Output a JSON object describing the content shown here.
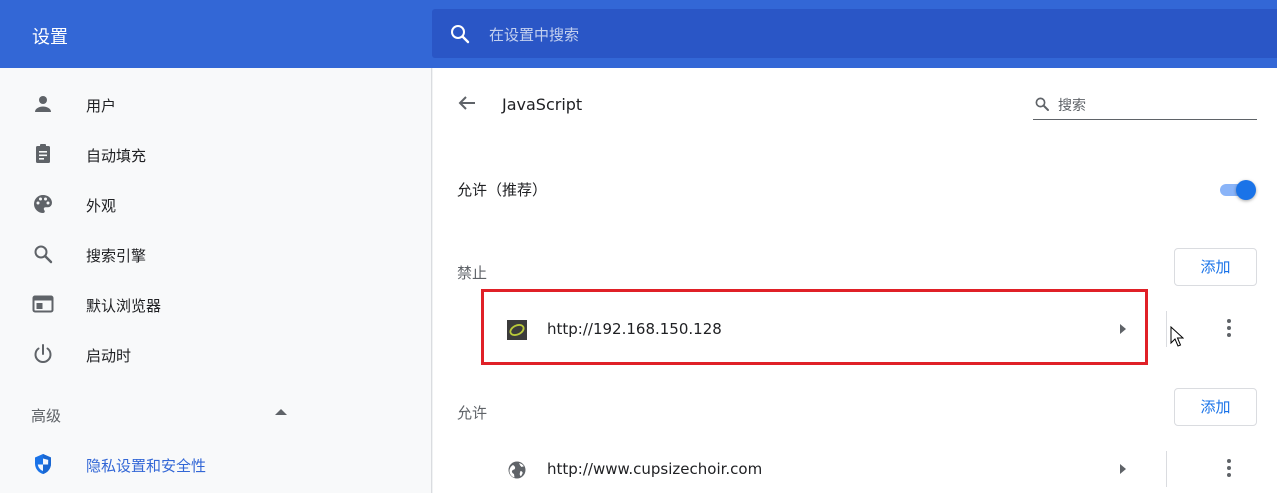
{
  "header": {
    "title": "设置",
    "search_placeholder": "在设置中搜索"
  },
  "sidebar": {
    "items": [
      {
        "label": "用户",
        "icon": "person-icon"
      },
      {
        "label": "自动填充",
        "icon": "clipboard-icon"
      },
      {
        "label": "外观",
        "icon": "palette-icon"
      },
      {
        "label": "搜索引擎",
        "icon": "search-icon"
      },
      {
        "label": "默认浏览器",
        "icon": "browser-window-icon"
      },
      {
        "label": "启动时",
        "icon": "power-icon"
      }
    ],
    "advanced_label": "高级",
    "active_item": {
      "label": "隐私设置和安全性",
      "icon": "shield-icon"
    }
  },
  "main": {
    "title": "JavaScript",
    "search_placeholder": "搜索",
    "allow_label": "允许（推荐）",
    "allow_enabled": true,
    "block_section": {
      "label": "禁止",
      "add_label": "添加",
      "sites": [
        {
          "url": "http://192.168.150.128"
        }
      ]
    },
    "allow_section": {
      "label": "允许",
      "add_label": "添加",
      "sites": [
        {
          "url": "http://www.cupsizechoir.com"
        }
      ]
    }
  },
  "colors": {
    "header_blue": "#3367d6",
    "search_blue": "#2a56c6",
    "accent": "#1a73e8",
    "highlight_red": "#e02027"
  }
}
